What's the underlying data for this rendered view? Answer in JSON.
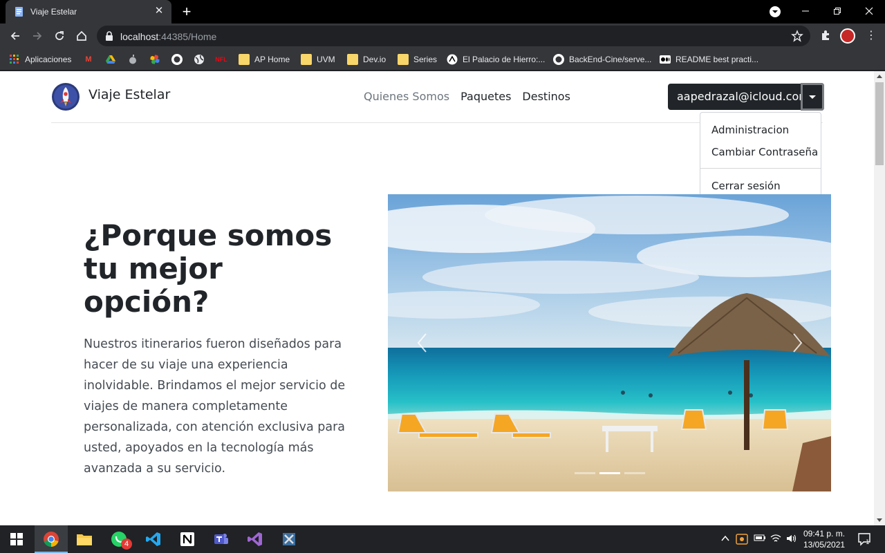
{
  "browser": {
    "tab_title": "Viaje Estelar",
    "url_host": "localhost",
    "url_rest": ":44385/Home",
    "bookmarks": [
      {
        "label": "Aplicaciones",
        "icon": "apps-grid-icon"
      },
      {
        "label": "",
        "icon": "gmail-icon"
      },
      {
        "label": "",
        "icon": "drive-icon"
      },
      {
        "label": "",
        "icon": "apple-icon"
      },
      {
        "label": "",
        "icon": "photos-icon"
      },
      {
        "label": "",
        "icon": "github-icon"
      },
      {
        "label": "",
        "icon": "globe-icon"
      },
      {
        "label": "",
        "icon": "netflix-icon"
      },
      {
        "label": "AP Home",
        "icon": "folder-icon"
      },
      {
        "label": "UVM",
        "icon": "folder-icon"
      },
      {
        "label": "Dev.io",
        "icon": "folder-icon"
      },
      {
        "label": "Series",
        "icon": "folder-icon"
      },
      {
        "label": "El Palacio de Hierro:...",
        "icon": "palacio-icon"
      },
      {
        "label": "BackEnd-Cine/serve...",
        "icon": "github-icon"
      },
      {
        "label": "README best practi...",
        "icon": "medium-icon"
      }
    ]
  },
  "site": {
    "brand": "Viaje Estelar",
    "nav": [
      "Quienes Somos",
      "Paquetes",
      "Destinos"
    ],
    "user_email": "aapedrazal@icloud.com",
    "dropdown": {
      "items": [
        "Administracion",
        "Cambiar Contraseña"
      ],
      "logout": "Cerrar sesión"
    },
    "hero": {
      "title": "¿Porque somos tu mejor opción?",
      "text": "Nuestros itinerarios fueron diseñados para hacer de su viaje una experiencia inolvidable. Brindamos el mejor servicio de viajes de manera completamente personalizada, con atención exclusiva para usted, apoyados en la tecnología más avanzada a su servicio."
    },
    "carousel": {
      "slides": 3,
      "active": 1
    }
  },
  "taskbar": {
    "apps": [
      "chrome-icon",
      "file-explorer-icon",
      "whatsapp-icon",
      "vscode-icon",
      "notion-icon",
      "teams-icon",
      "visual-studio-icon",
      "tools-icon"
    ],
    "whatsapp_badge": "4",
    "time": "09:41 p. m.",
    "date": "13/05/2021",
    "notifications": "1"
  },
  "colors": {
    "chrome_dark": "#35363a",
    "navbar_button": "#212529",
    "sea": "#1fb3c4",
    "sand": "#e7d2ad"
  }
}
